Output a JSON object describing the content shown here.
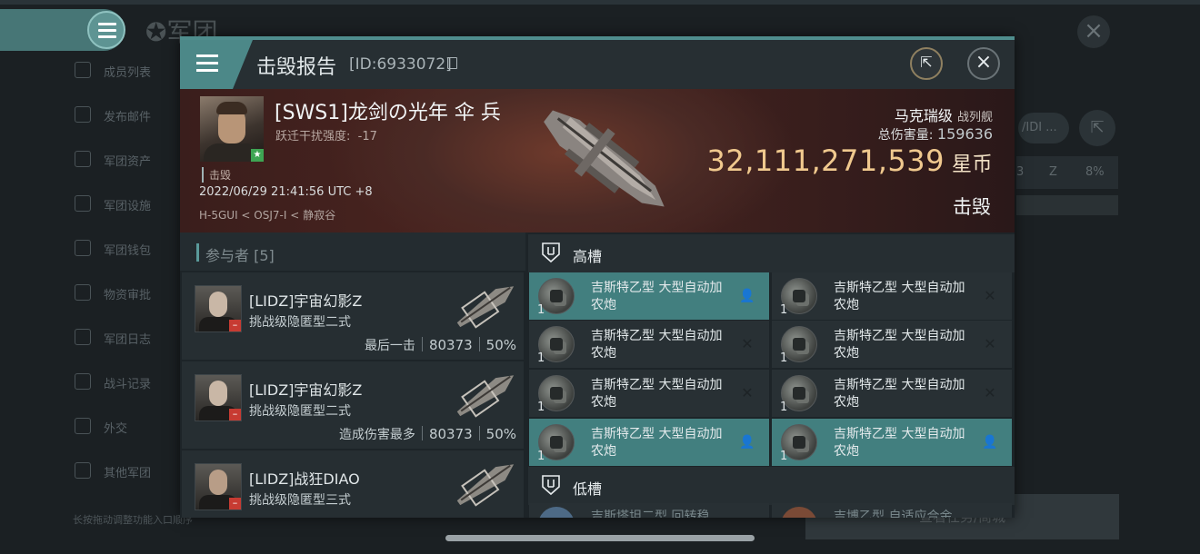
{
  "background": {
    "title": "军团",
    "sidebar": [
      "成员列表",
      "发布邮件",
      "军团资产",
      "军团设施",
      "军团钱包",
      "物资审批",
      "军团日志",
      "战斗记录",
      "外交",
      "其他军团"
    ],
    "hint": "长按拖动调整功能入口顺序",
    "right_button": "/IDI ...",
    "right_row": [
      "3",
      "Z",
      "8%"
    ],
    "bottom_button": "查看任务/商城"
  },
  "modal": {
    "title": "击毁报告",
    "id": "[ID:6933072]",
    "victim": {
      "name": "[SWS1]龙剑の光年 伞 兵",
      "warp_label": "跃迁干扰强度:",
      "warp_value": "-17",
      "tag": "击毁",
      "time": "2022/06/29 21:41:56 UTC +8",
      "location": "H-5GUI < OSJ7-I < 静寂谷"
    },
    "ship": {
      "name": "马克瑞级",
      "class": "战列舰",
      "total_damage_label": "总伤害量:",
      "total_damage": "159636",
      "value": "32,111,271,539",
      "currency": "星币",
      "status": "击毁"
    },
    "participants": {
      "header": "参与者 [5]",
      "list": [
        {
          "name": "[LIDZ]宇宙幻影Z",
          "ship": "挑战级隐匿型二式",
          "label": "最后一击",
          "damage": "80373",
          "percent": "50%"
        },
        {
          "name": "[LIDZ]宇宙幻影Z",
          "ship": "挑战级隐匿型二式",
          "label": "造成伤害最多",
          "damage": "80373",
          "percent": "50%"
        },
        {
          "name": "[LIDZ]战狂DIAO",
          "ship": "挑战级隐匿型三式",
          "label": "",
          "damage": "",
          "percent": ""
        }
      ]
    },
    "high_slot": {
      "title": "高槽",
      "modules": [
        {
          "qty": "1",
          "name": "吉斯特乙型 大型自动加农炮",
          "state": "person",
          "highlight": true
        },
        {
          "qty": "1",
          "name": "吉斯特乙型 大型自动加农炮",
          "state": "destroyed",
          "highlight": false
        },
        {
          "qty": "1",
          "name": "吉斯特乙型 大型自动加农炮",
          "state": "destroyed",
          "highlight": false
        },
        {
          "qty": "1",
          "name": "吉斯特乙型 大型自动加农炮",
          "state": "destroyed",
          "highlight": false
        },
        {
          "qty": "1",
          "name": "吉斯特乙型 大型自动加农炮",
          "state": "destroyed",
          "highlight": false
        },
        {
          "qty": "1",
          "name": "吉斯特乙型 大型自动加农炮",
          "state": "destroyed",
          "highlight": false
        },
        {
          "qty": "1",
          "name": "吉斯特乙型 大型自动加农炮",
          "state": "person",
          "highlight": true
        },
        {
          "qty": "1",
          "name": "吉斯特乙型 大型自动加农炮",
          "state": "person",
          "highlight": true
        }
      ]
    },
    "low_slot": {
      "title": "低槽",
      "partial": [
        "吉斯塔坦二型 回转稳",
        "吉博乙型 自适应合金"
      ]
    }
  }
}
